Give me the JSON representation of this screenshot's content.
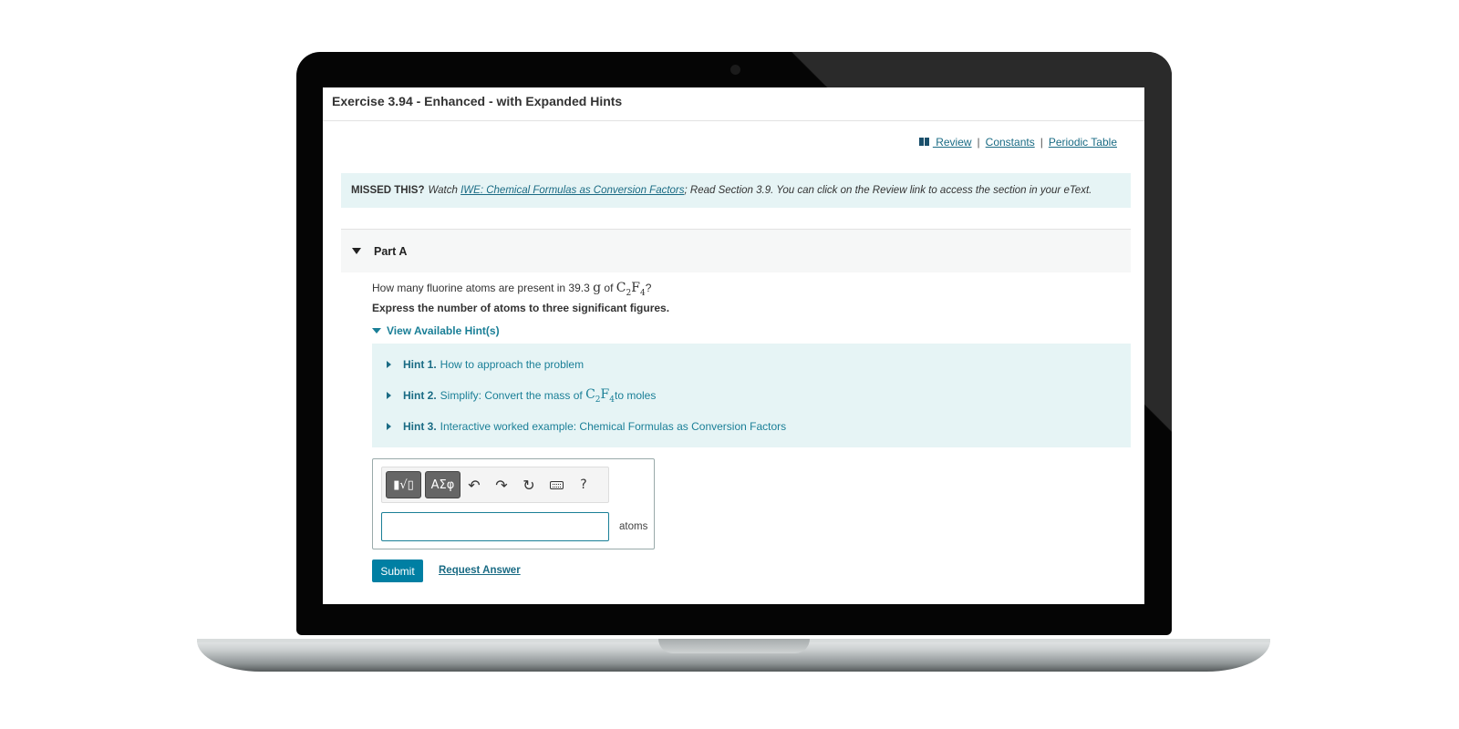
{
  "exercise": {
    "title": "Exercise 3.94 - Enhanced - with Expanded Hints"
  },
  "top_links": {
    "review": " Review",
    "sep1": "|",
    "constants": "Constants",
    "sep2": "|",
    "periodic_table": "Periodic Table"
  },
  "missed": {
    "label": "MISSED THIS?",
    "watch": "Watch",
    "link": "IWE: Chemical Formulas as Conversion Factors",
    "rest": "; Read Section 3.9. You can click on the Review link to access the section in your eText."
  },
  "part": {
    "label": "Part A"
  },
  "question": {
    "prefix": "How many fluorine atoms are present in 39.3 ",
    "unit_g": "g",
    "of": " of ",
    "formula_c": "C",
    "formula_c_sub": "2",
    "formula_f": "F",
    "formula_f_sub": "4",
    "suffix": "?",
    "instruction": "Express the number of atoms to three significant figures."
  },
  "hints": {
    "toggle_label": "View Available Hint(s)",
    "items": [
      {
        "number": "Hint 1.",
        "text": "How to approach the problem"
      },
      {
        "number": "Hint 2.",
        "text": "Simplify: Convert the mass of ",
        "formula_c": "C",
        "formula_c_sub": "2",
        "formula_f": "F",
        "formula_f_sub": "4",
        "text_after": " to moles"
      },
      {
        "number": "Hint 3.",
        "text": "Interactive worked example: Chemical Formulas as Conversion Factors"
      }
    ]
  },
  "toolbar": {
    "templates_glyph": "▮√▯",
    "symbols_glyph": "ΑΣφ",
    "undo_glyph": "↶",
    "redo_glyph": "↷",
    "reset_glyph": "↻",
    "help_glyph": "?"
  },
  "answer": {
    "value": "",
    "unit": "atoms"
  },
  "actions": {
    "submit": "Submit",
    "request_answer": "Request Answer"
  },
  "colors": {
    "accent": "#007fa3",
    "link": "#1a6b84",
    "hint_bg": "#e6f4f5"
  }
}
